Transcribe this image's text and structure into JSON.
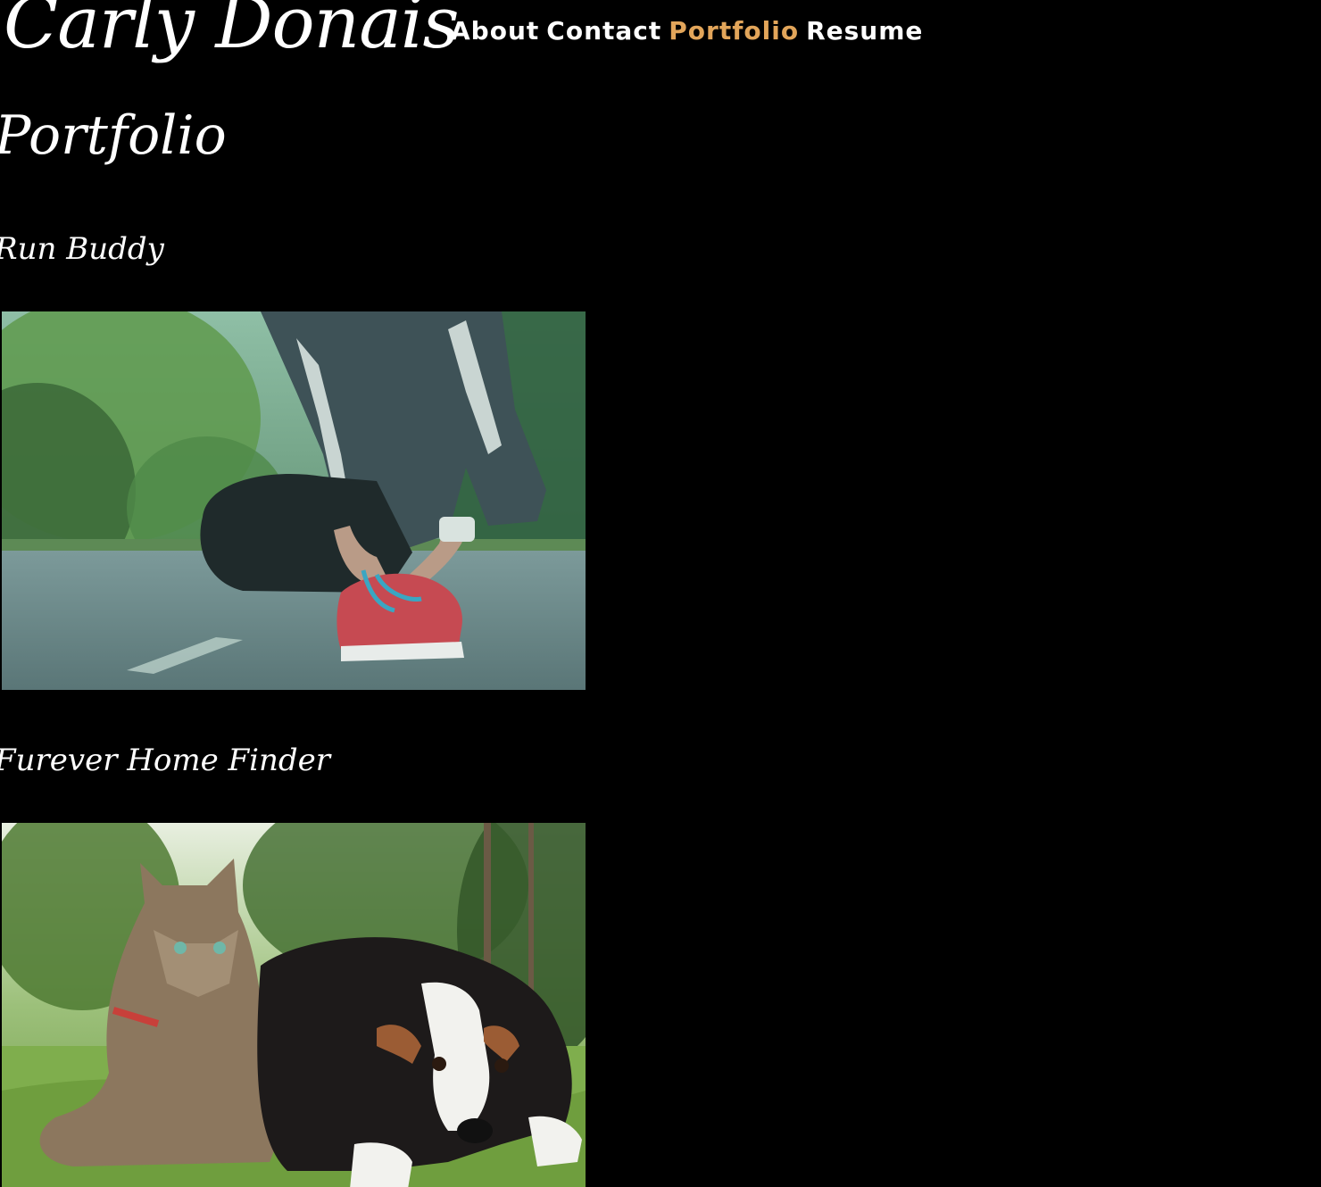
{
  "header": {
    "site_title": "Carly Donais",
    "nav": [
      {
        "label": "About",
        "active": false
      },
      {
        "label": "Contact",
        "active": false
      },
      {
        "label": "Portfolio",
        "active": true
      },
      {
        "label": "Resume",
        "active": false
      }
    ]
  },
  "main": {
    "page_title": "Portfolio",
    "projects": [
      {
        "title": "Run Buddy",
        "image": "runner-tying-shoe-image"
      },
      {
        "title": "Furever Home Finder",
        "image": "cat-and-puppy-image"
      }
    ]
  },
  "colors": {
    "background": "#000000",
    "text": "#ffffff",
    "accent": "#e2a55a"
  }
}
